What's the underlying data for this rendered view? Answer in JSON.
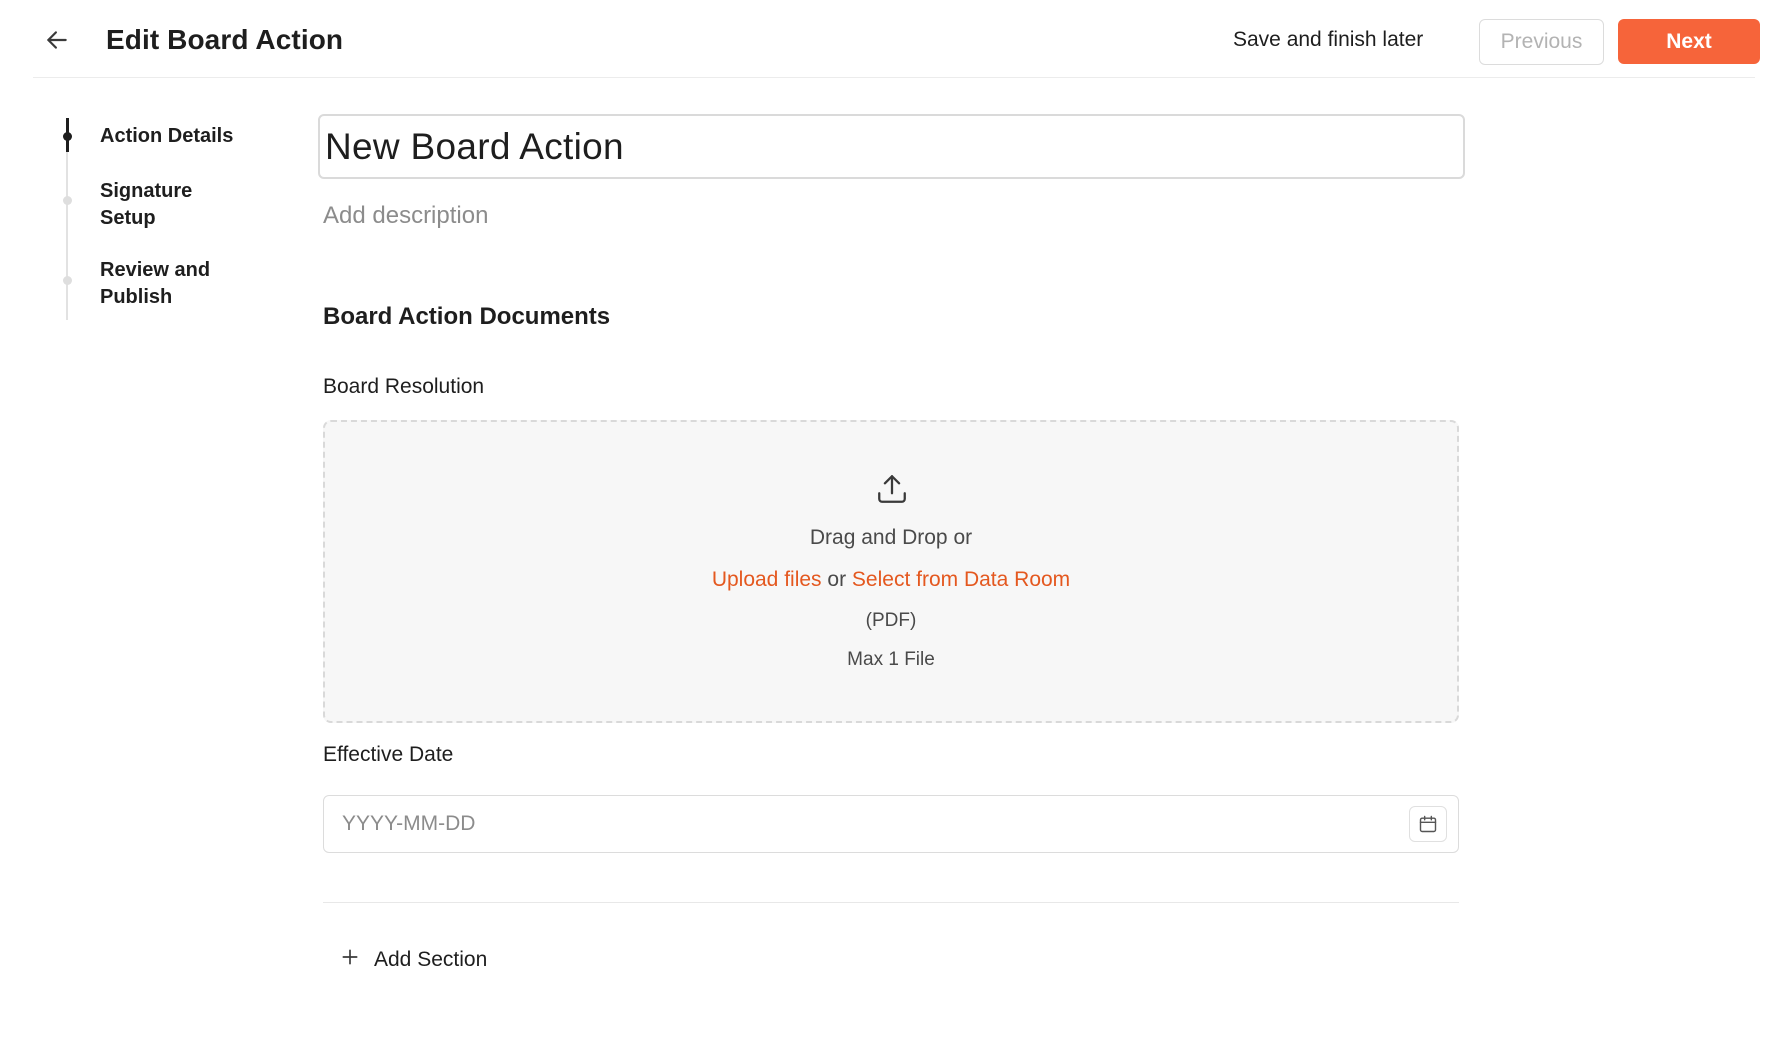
{
  "header": {
    "title": "Edit Board Action",
    "save_later_label": "Save and finish later",
    "previous_label": "Previous",
    "next_label": "Next"
  },
  "steps": [
    {
      "label": "Action Details",
      "active": true
    },
    {
      "label": "Signature Setup",
      "active": false
    },
    {
      "label": "Review and Publish",
      "active": false
    }
  ],
  "form": {
    "title_value": "New Board Action",
    "description_placeholder": "Add description",
    "section_title": "Board Action Documents",
    "resolution_label": "Board Resolution",
    "dropzone": {
      "drag_text": "Drag and Drop or",
      "upload_link": "Upload files",
      "or_text": "or",
      "data_room_link": "Select from Data Room",
      "file_types": "(PDF)",
      "max_files": "Max 1 File"
    },
    "effective_date_label": "Effective Date",
    "effective_date_placeholder": "YYYY-MM-DD",
    "add_section_label": "Add Section"
  },
  "colors": {
    "accent": "#f6643a",
    "link": "#e4581f"
  }
}
